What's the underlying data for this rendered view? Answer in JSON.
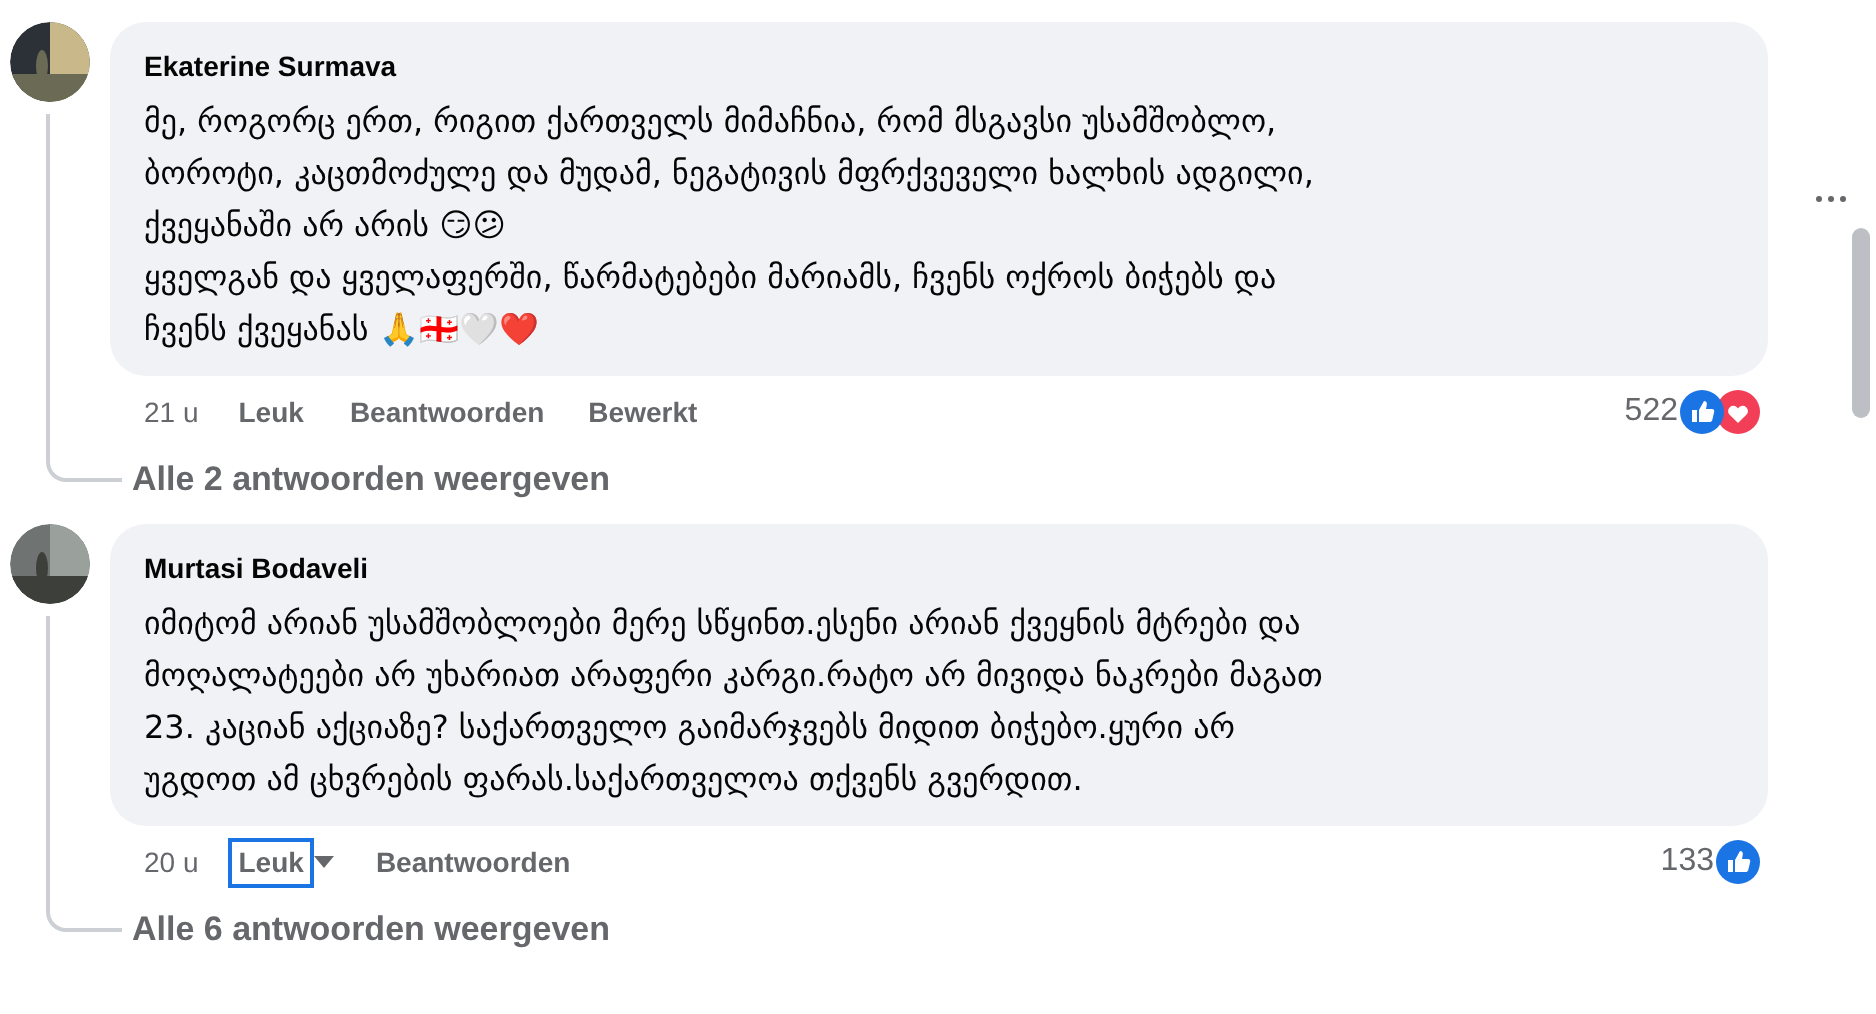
{
  "comments": [
    {
      "author": "Ekaterine Surmava",
      "text": "მე, როგორც ერთ, რიგით ქართველს მიმაჩნია, რომ მსგავსი უსამშობლო,\nბოროტი, კაცთმოძულე და მუდამ, ნეგატივის მფრქვეველი ხალხის ადგილი,\nქვეყანაში არ არის 😏😕\nყველგან და ყველაფერში, წარმატებები მარიამს, ჩვენს ოქროს ბიჭებს და\nჩვენს ქვეყანას 🙏🇬🇪🤍❤️",
      "time": "21 u",
      "like": "Leuk",
      "like_focused": false,
      "like_menu": false,
      "reply": "Beantwoorden",
      "edited": "Bewerkt",
      "reaction_count": "522",
      "reactions": [
        {
          "kind": "like"
        },
        {
          "kind": "love"
        }
      ],
      "more_menu": true,
      "replies_link": "Alle 2 antwoorden weergeven"
    },
    {
      "author": "Murtasi Bodaveli",
      "text": "იმიტომ არიან უსამშობლოები მერე სწყინთ.ესენი არიან ქვეყნის მტრები და\nმოღალატეები არ უხარიათ არაფერი კარგი.რატო არ მივიდა ნაკრები მაგათ\n23. კაციან აქციაზე? საქართველო გაიმარჯვებს მიდით ბიჭებო.ყური არ\nუგდოთ ამ ცხვრების ფარას.საქართველოა თქვენს გვერდით.",
      "time": "20 u",
      "like": "Leuk",
      "like_focused": true,
      "like_menu": true,
      "reply": "Beantwoorden",
      "reaction_count": "133",
      "reactions": [
        {
          "kind": "like"
        }
      ],
      "more_menu": false,
      "replies_link": "Alle 6 antwoorden weergeven"
    }
  ]
}
